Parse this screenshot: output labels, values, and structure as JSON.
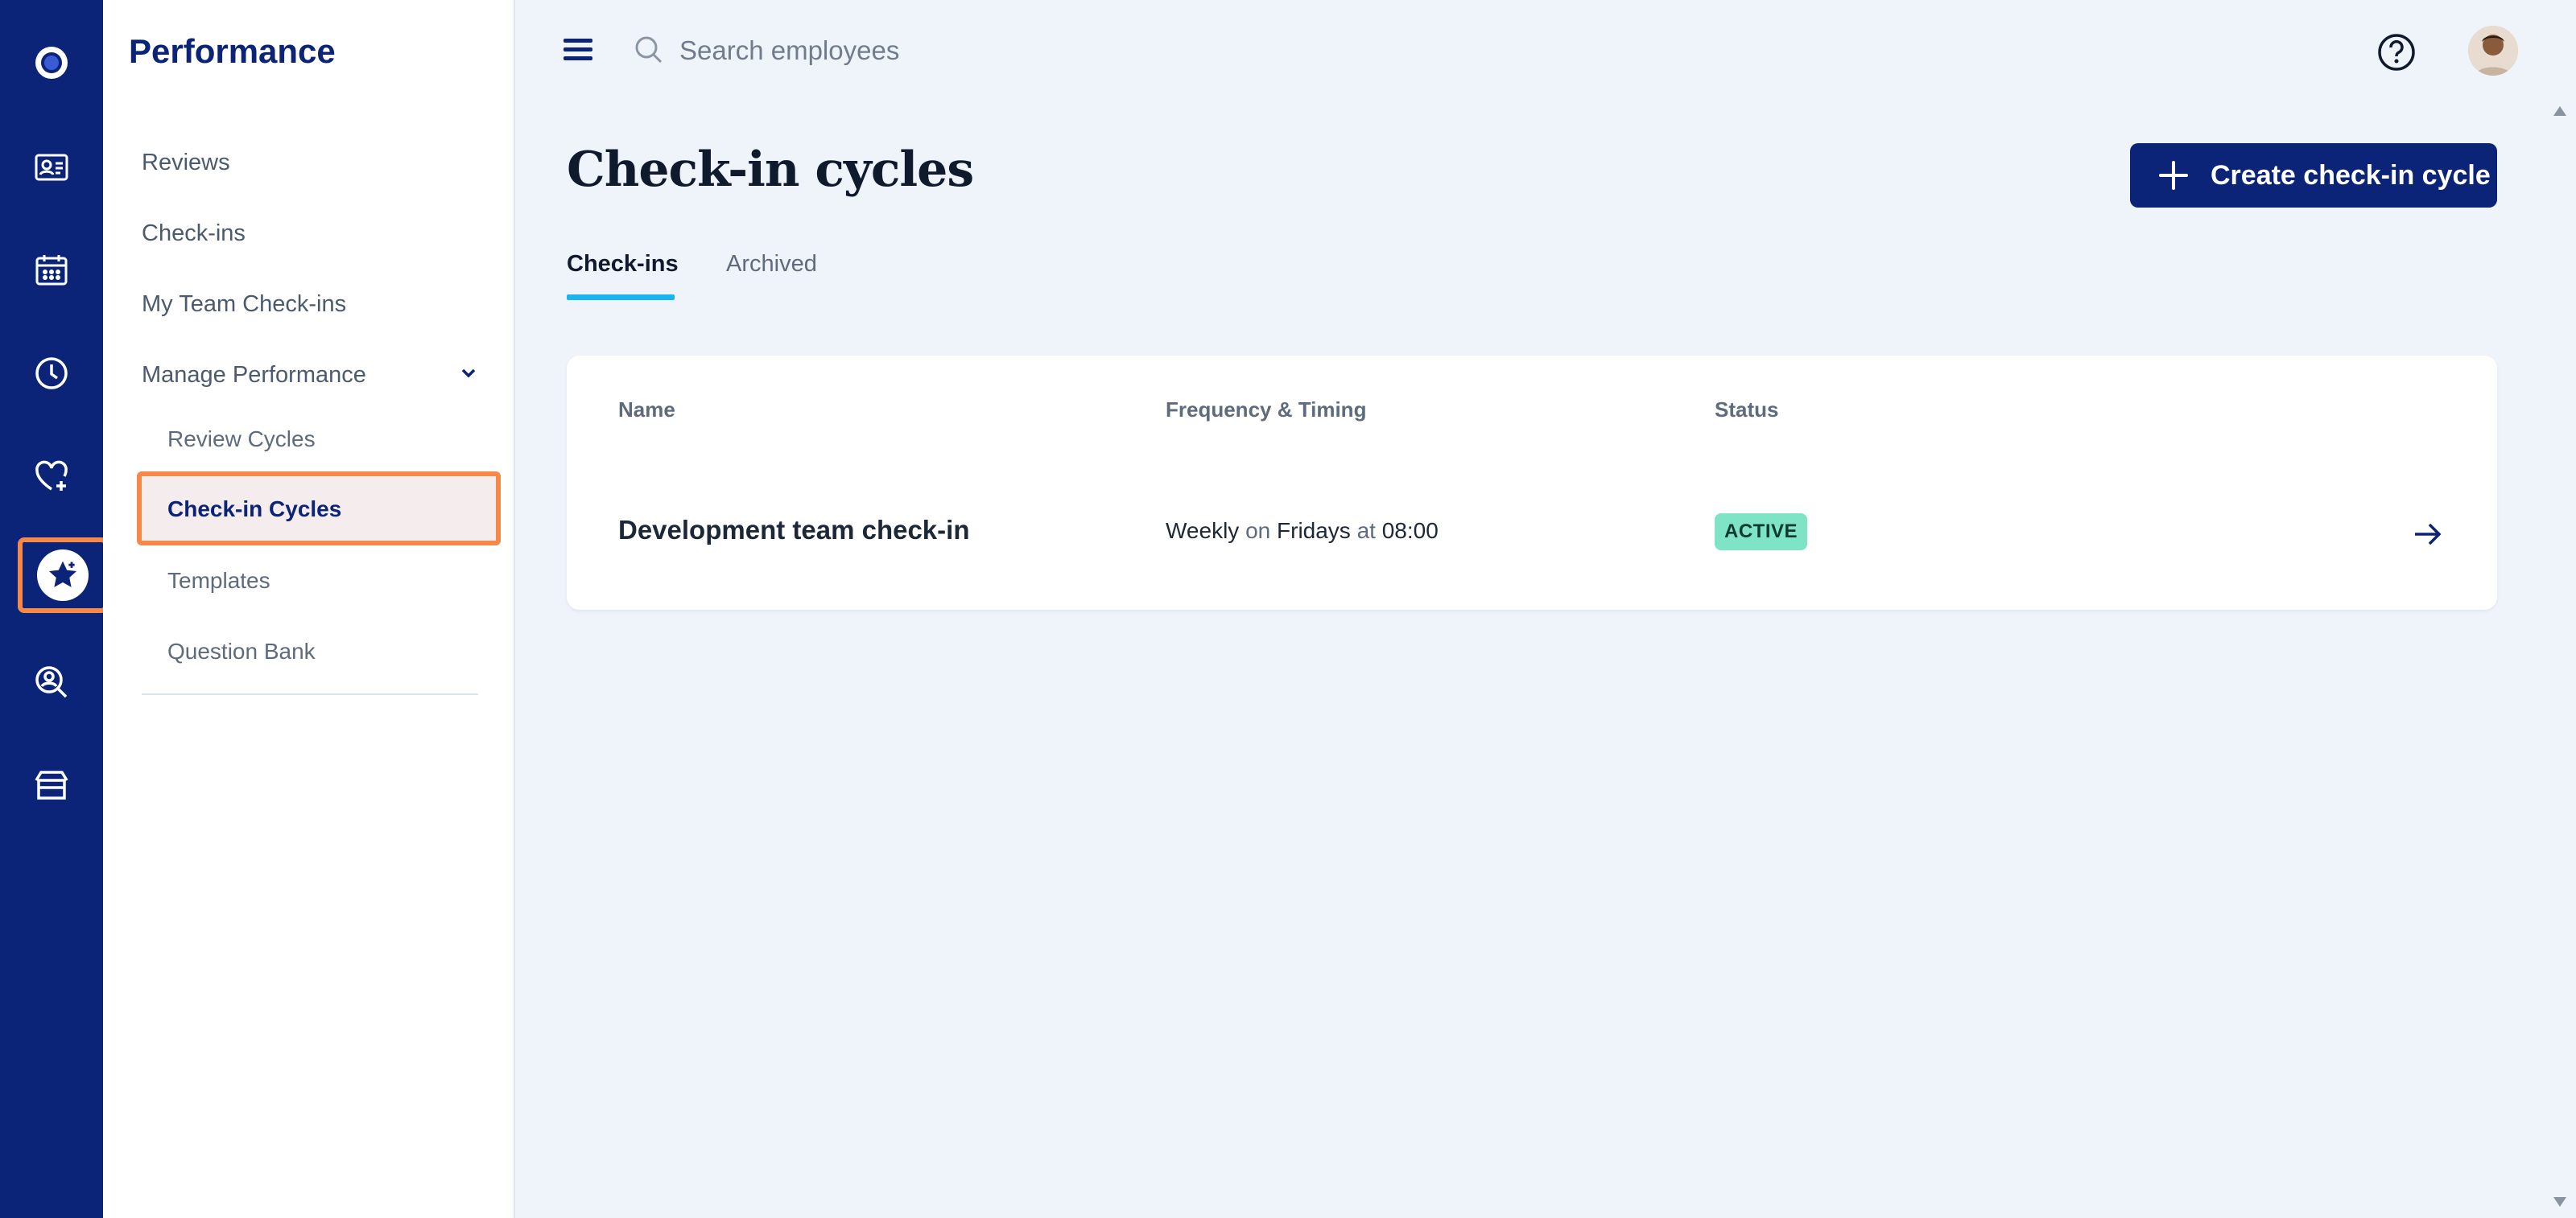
{
  "app": {
    "section_title": "Performance"
  },
  "rail": {
    "items": [
      "logo-icon",
      "employee-card-icon",
      "calendar-icon",
      "clock-icon",
      "heart-plus-icon",
      "star-icon",
      "person-search-icon",
      "box-icon"
    ],
    "active_index": 5
  },
  "sidebar": {
    "items": [
      {
        "label": "Reviews"
      },
      {
        "label": "Check-ins"
      },
      {
        "label": "My Team Check-ins"
      },
      {
        "label": "Manage Performance"
      }
    ],
    "sub_items": [
      {
        "label": "Review Cycles"
      },
      {
        "label": "Check-in Cycles"
      },
      {
        "label": "Templates"
      },
      {
        "label": "Question Bank"
      }
    ],
    "active_sub": "Check-in Cycles"
  },
  "topbar": {
    "search_placeholder": "Search employees"
  },
  "page": {
    "title": "Check-in cycles",
    "create_button": "Create check-in cycle",
    "tabs": [
      {
        "label": "Check-ins",
        "active": true
      },
      {
        "label": "Archived",
        "active": false
      }
    ]
  },
  "table": {
    "headers": {
      "name": "Name",
      "frequency": "Frequency & Timing",
      "status": "Status"
    },
    "rows": [
      {
        "name": "Development team check-in",
        "frequency": "Weekly",
        "on": "on",
        "day": "Fridays",
        "at": "at",
        "time": "08:00",
        "status": "ACTIVE"
      }
    ]
  },
  "colors": {
    "brand": "#0b2478",
    "highlight": "#f5894a",
    "tab_underline": "#18b5ee",
    "status_active": "#7fe3c6"
  }
}
